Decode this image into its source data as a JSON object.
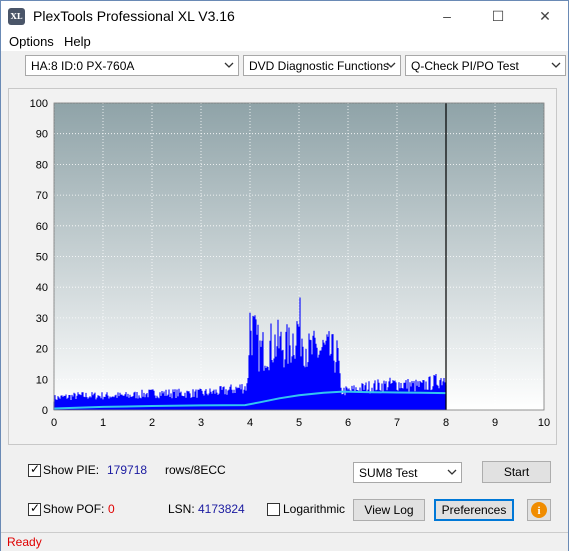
{
  "window": {
    "title": "PlexTools Professional XL V3.16",
    "icon_text": "XL",
    "minimize": "–",
    "maximize": "☐",
    "close": "✕"
  },
  "menu": {
    "options": "Options",
    "help": "Help"
  },
  "toolbar": {
    "device": "HA:8 ID:0  PX-760A",
    "function": "DVD Diagnostic Functions",
    "test": "Q-Check PI/PO Test"
  },
  "chart_data": {
    "type": "area",
    "xlim": [
      0,
      10
    ],
    "ylim": [
      0,
      100
    ],
    "x_ticks": [
      "0",
      "1",
      "2",
      "3",
      "4",
      "5",
      "6",
      "7",
      "8",
      "9",
      "10"
    ],
    "y_ticks": [
      "100",
      "90",
      "80",
      "70",
      "60",
      "50",
      "40",
      "30",
      "20",
      "10",
      "0"
    ],
    "grid": true,
    "end_marker_x": 8.0,
    "series": [
      {
        "color": "#0000ff",
        "style": "bars",
        "x": [
          0,
          0.5,
          1,
          1.5,
          2,
          2.5,
          3,
          3.5,
          3.95,
          4.0,
          4.2,
          4.5,
          4.8,
          5.0,
          5.2,
          5.5,
          5.8,
          5.85,
          6.0,
          6.5,
          7.0,
          7.5,
          7.8,
          8.0
        ],
        "values": [
          5,
          6,
          6,
          6,
          7,
          7,
          7,
          8,
          10,
          39,
          26,
          30,
          28,
          38,
          26,
          27,
          24,
          8,
          8,
          10,
          11,
          10,
          12,
          14
        ]
      },
      {
        "color": "#33c4f0",
        "style": "line",
        "x": [
          0,
          1,
          2,
          3,
          3.9,
          4.2,
          4.6,
          5.0,
          5.5,
          5.9,
          6.5,
          7.0,
          7.5,
          8.0
        ],
        "values": [
          0.5,
          1,
          1.3,
          1.5,
          1.6,
          2.5,
          3.8,
          4.8,
          5.6,
          6.0,
          5.8,
          5.7,
          5.6,
          5.5
        ]
      }
    ]
  },
  "controls": {
    "show_pie_label": "Show PIE:",
    "pie_value": "179718",
    "rows_label": "rows/8ECC",
    "show_pof_label": "Show POF:",
    "pof_value": "0",
    "lsn_label": "LSN:",
    "lsn_value": "4173824",
    "logarithmic_label": "Logarithmic",
    "sum8_select": "SUM8 Test",
    "start_button": "Start",
    "view_log_button": "View Log",
    "preferences_button": "Preferences",
    "info_icon_glyph": "i",
    "checkmark": "✓"
  },
  "status": {
    "text": "Ready"
  }
}
